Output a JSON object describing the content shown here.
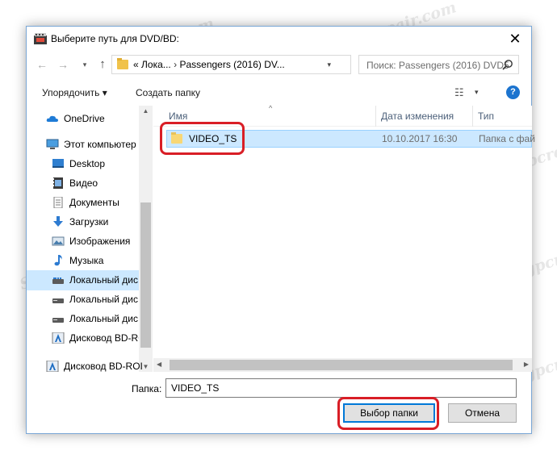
{
  "window": {
    "title": "Выберите путь для DVD/BD:",
    "close_glyph": "✕"
  },
  "nav": {
    "back_glyph": "←",
    "forward_glyph": "→",
    "recent_glyph": "▾",
    "up_glyph": "↑",
    "address_prefix": "«",
    "address_parts": [
      "Лока...",
      "›",
      "Passengers (2016) DV..."
    ],
    "address_drop_glyph": "▾",
    "refresh_glyph": "↻",
    "search_placeholder": "Поиск: Passengers (2016) DVD5"
  },
  "toolbar": {
    "organize_label": "Упорядочить ▾",
    "new_folder_label": "Создать папку",
    "view_glyph": "☷",
    "view_drop_glyph": "▾",
    "help_glyph": "?"
  },
  "sidebar": {
    "items": [
      {
        "label": "OneDrive",
        "icon": "cloud-icon"
      },
      {
        "label": "Этот компьютер",
        "icon": "computer-icon"
      },
      {
        "label": "Desktop",
        "icon": "desktop-icon"
      },
      {
        "label": "Видео",
        "icon": "video-icon"
      },
      {
        "label": "Документы",
        "icon": "documents-icon"
      },
      {
        "label": "Загрузки",
        "icon": "download-icon"
      },
      {
        "label": "Изображения",
        "icon": "images-icon"
      },
      {
        "label": "Музыка",
        "icon": "music-icon"
      },
      {
        "label": "Локальный дис",
        "icon": "drive-icon"
      },
      {
        "label": "Локальный дис",
        "icon": "drive-icon"
      },
      {
        "label": "Локальный дис",
        "icon": "drive-icon"
      },
      {
        "label": "Дисковод BD-RO",
        "icon": "optical-drive-icon"
      }
    ],
    "bottom_item": {
      "label": "Дисковод BD-ROI",
      "icon": "optical-drive-icon"
    },
    "scroll_up_glyph": "▲",
    "scroll_down_glyph": "▼"
  },
  "files": {
    "columns": [
      "Имя",
      "Дата изменения",
      "Тип"
    ],
    "sort_glyph": "^",
    "rows": [
      {
        "name": "VIDEO_TS",
        "date": "10.10.2017 16:30",
        "type": "Папка с фай"
      }
    ],
    "hscroll_left_glyph": "◀",
    "hscroll_right_glyph": "▶"
  },
  "footer": {
    "folder_label": "Папка:",
    "folder_value": "VIDEO_TS",
    "select_button": "Выбор папки",
    "cancel_button": "Отмена"
  },
  "colors": {
    "highlight": "#d91e26",
    "selection": "#cce8ff",
    "accent": "#0078d7"
  },
  "watermark": "Soringpcrepair.com"
}
